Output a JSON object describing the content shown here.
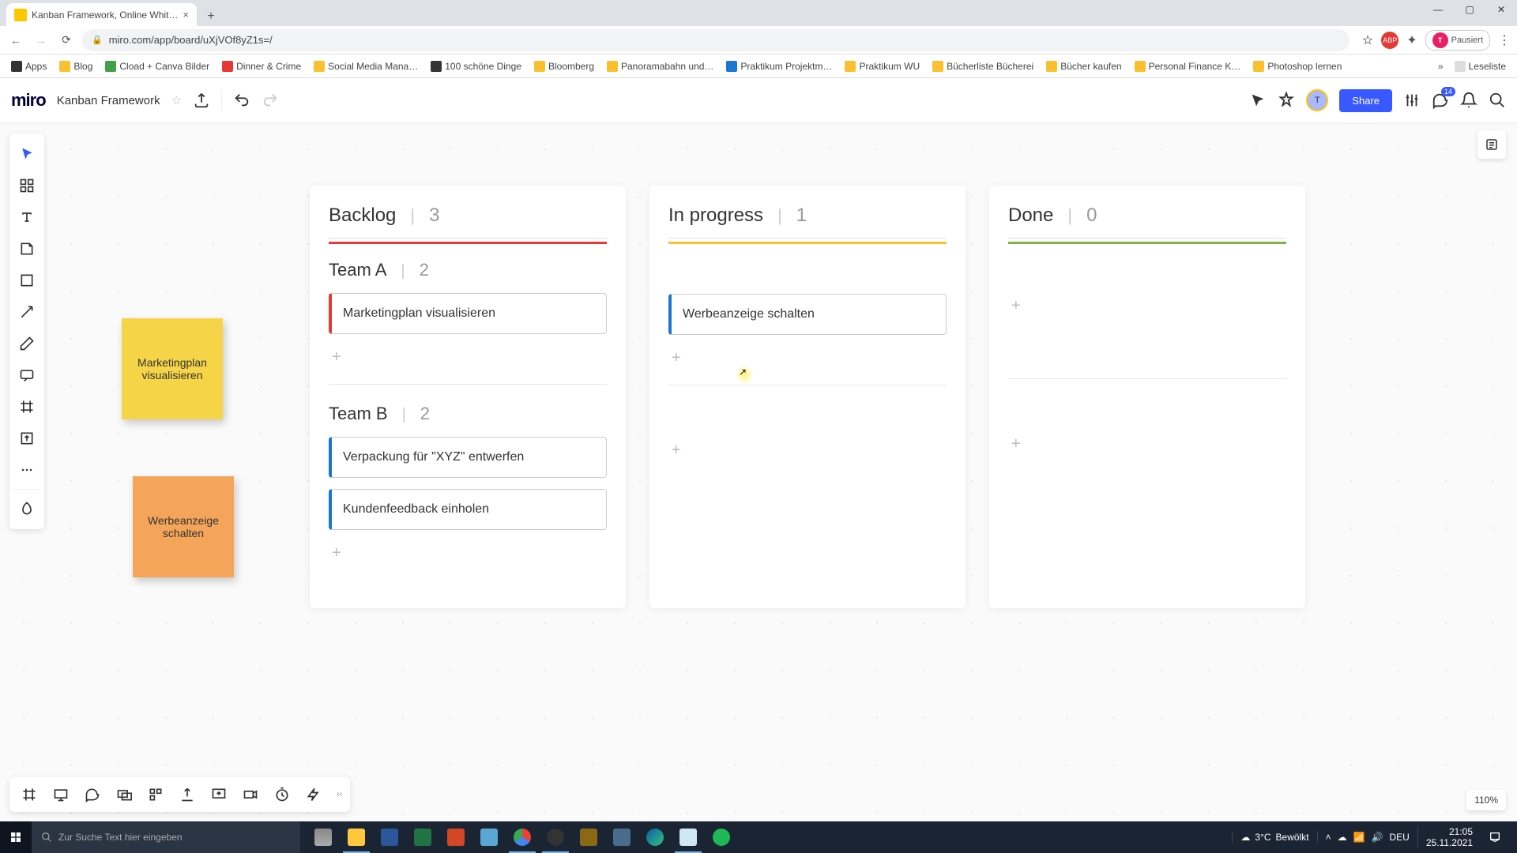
{
  "browser": {
    "tab_title": "Kanban Framework, Online Whit…",
    "url": "miro.com/app/board/uXjVOf8yZ1s=/",
    "star_icon": "☆",
    "extensions_icon": "✦",
    "abp_label": "ABP",
    "avatar_letter": "T",
    "paused_label": "Pausiert",
    "menu_icon": "⋮",
    "reading_list": "Leseliste",
    "bookmarks": [
      {
        "label": "Apps",
        "cls": "b"
      },
      {
        "label": "Blog",
        "cls": "y"
      },
      {
        "label": "Cload + Canva Bilder",
        "cls": "g"
      },
      {
        "label": "Dinner & Crime",
        "cls": "r"
      },
      {
        "label": "Social Media Mana…",
        "cls": "y"
      },
      {
        "label": "100 schöne Dinge",
        "cls": "b"
      },
      {
        "label": "Bloomberg",
        "cls": "y"
      },
      {
        "label": "Panoramabahn und…",
        "cls": "y"
      },
      {
        "label": "Praktikum Projektm…",
        "cls": "bl"
      },
      {
        "label": "Praktikum WU",
        "cls": "y"
      },
      {
        "label": "Bücherliste Bücherei",
        "cls": "y"
      },
      {
        "label": "Bücher kaufen",
        "cls": "y"
      },
      {
        "label": "Personal Finance K…",
        "cls": "y"
      },
      {
        "label": "Photoshop lernen",
        "cls": "y"
      }
    ]
  },
  "miro": {
    "logo": "miro",
    "board_name": "Kanban Framework",
    "share": "Share",
    "avatar_letter": "T",
    "notif_count": "14",
    "zoom": "110%"
  },
  "sticky1": "Marketingplan visualisieren",
  "sticky2": "Werbeanzeige schalten",
  "kanban": {
    "columns": [
      {
        "title": "Backlog",
        "count": "3",
        "bar": "red"
      },
      {
        "title": "In progress",
        "count": "1",
        "bar": "yellow"
      },
      {
        "title": "Done",
        "count": "0",
        "bar": "green"
      }
    ],
    "swimlanes": [
      {
        "title": "Team A",
        "count": "2"
      },
      {
        "title": "Team B",
        "count": "2"
      }
    ],
    "cards": {
      "backlog_a": [
        {
          "text": "Marketingplan visualisieren",
          "color": "red"
        }
      ],
      "backlog_b": [
        {
          "text": "Verpackung für \"XYZ\" entwerfen",
          "color": "blue"
        },
        {
          "text": "Kundenfeedback einholen",
          "color": "blue"
        }
      ],
      "progress_a": [
        {
          "text": "Werbeanzeige schalten",
          "color": "blue"
        }
      ]
    }
  },
  "taskbar": {
    "search_placeholder": "Zur Suche Text hier eingeben",
    "weather_temp": "3°C",
    "weather_desc": "Bewölkt",
    "lang": "DEU",
    "time": "21:05",
    "date": "25.11.2021"
  }
}
